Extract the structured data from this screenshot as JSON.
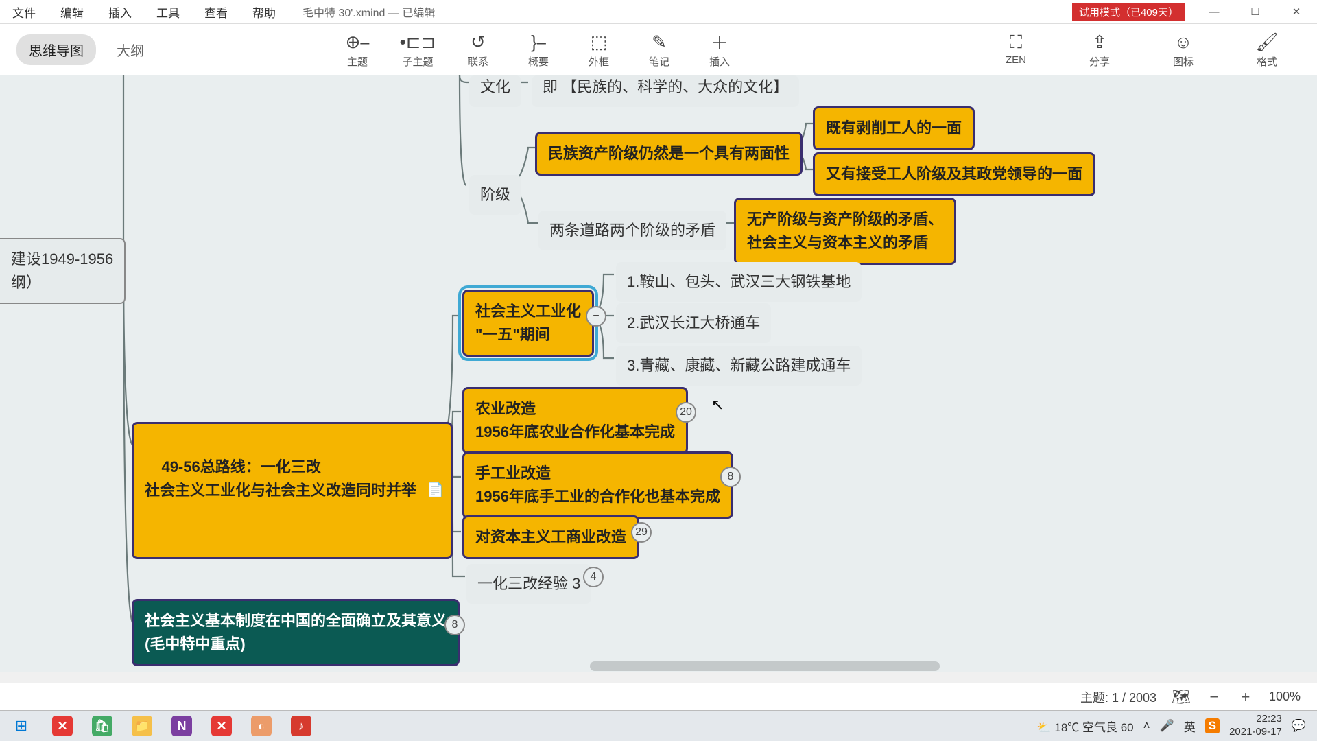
{
  "menu": {
    "file": "文件",
    "edit": "编辑",
    "insert": "插入",
    "tools": "工具",
    "view": "查看",
    "help": "帮助"
  },
  "doc": {
    "title": "毛中特 30'.xmind — 已编辑"
  },
  "trial": "试用模式（已409天）",
  "tabs": {
    "mindmap": "思维导图",
    "outline": "大纲"
  },
  "toolbar": {
    "topic": "主题",
    "subtopic": "子主题",
    "relation": "联系",
    "summary": "概要",
    "boundary": "外框",
    "notes": "笔记",
    "insertBtn": "插入",
    "zen": "ZEN",
    "share": "分享",
    "marker": "图标",
    "format": "格式"
  },
  "nodes": {
    "root": "建设1949-1956\n纲）",
    "culture": "文化",
    "cultureDetail": "即 【民族的、科学的、大众的文化】",
    "classLbl": "阶级",
    "bourgeois": "民族资产阶级仍然是一个具有两面性",
    "exploit": "既有剥削工人的一面",
    "ledBy": "又有接受工人阶级及其政党领导的一面",
    "twoRoads": "两条道路两个阶级的矛盾",
    "contradict": "无产阶级与资产阶级的矛盾、\n社会主义与资本主义的矛盾",
    "line49": "49-56总路线：一化三改\n社会主义工业化与社会主义改造同时并举",
    "indus": "社会主义工业化\n\"一五\"期间",
    "steel": "1.鞍山、包头、武汉三大钢铁基地",
    "bridge": "2.武汉长江大桥通车",
    "roads": "3.青藏、康藏、新藏公路建成通车",
    "agri": "农业改造\n1956年底农业合作化基本完成",
    "handi": "手工业改造\n1956年底手工业的合作化也基本完成",
    "capital": "对资本主义工商业改造",
    "exp": "一化三改经验 3",
    "system": "社会主义基本制度在中国的全面确立及其意义\n(毛中特中重点)"
  },
  "badges": {
    "agri": "20",
    "handi": "8",
    "capital": "29",
    "exp": "4",
    "system": "8"
  },
  "status": {
    "topic": "主题: 1 / 2003",
    "zoom": "100%"
  },
  "tray": {
    "weather": "18℃ 空气良 60",
    "ime": "英",
    "time": "22:23",
    "date": "2021-09-17"
  },
  "win": {
    "min": "—",
    "max": "☐",
    "close": "✕"
  }
}
